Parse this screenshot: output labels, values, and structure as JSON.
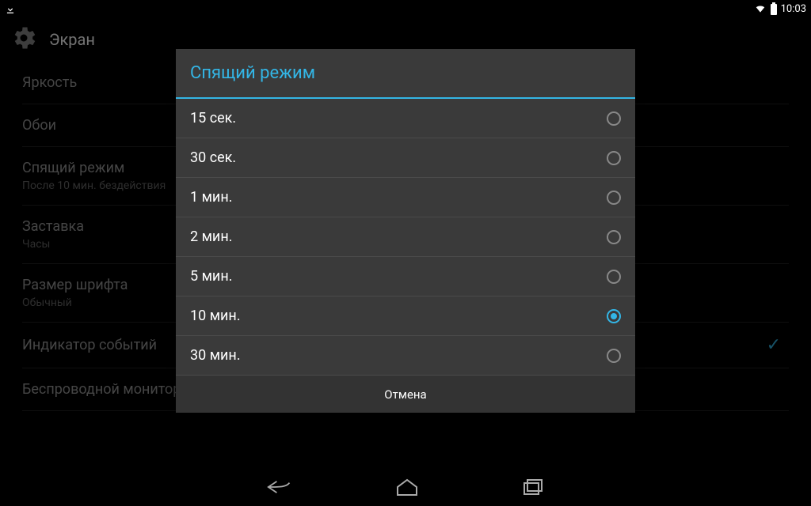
{
  "statusbar": {
    "time": "10:03"
  },
  "header": {
    "title": "Экран"
  },
  "settings": {
    "brightness": {
      "label": "Яркость"
    },
    "wallpaper": {
      "label": "Обои"
    },
    "sleep": {
      "label": "Спящий режим",
      "sub": "После 10 мин. бездействия"
    },
    "daydream": {
      "label": "Заставка",
      "sub": "Часы"
    },
    "fontsize": {
      "label": "Размер шрифта",
      "sub": "Обычный"
    },
    "indicator": {
      "label": "Индикатор событий"
    },
    "wireless": {
      "label": "Беспроводной монитор"
    }
  },
  "dialog": {
    "title": "Спящий режим",
    "options": [
      {
        "label": "15 сек.",
        "selected": false
      },
      {
        "label": "30 сек.",
        "selected": false
      },
      {
        "label": "1 мин.",
        "selected": false
      },
      {
        "label": "2 мин.",
        "selected": false
      },
      {
        "label": "5 мин.",
        "selected": false
      },
      {
        "label": "10 мин.",
        "selected": true
      },
      {
        "label": "30 мин.",
        "selected": false
      }
    ],
    "cancel": "Отмена"
  }
}
